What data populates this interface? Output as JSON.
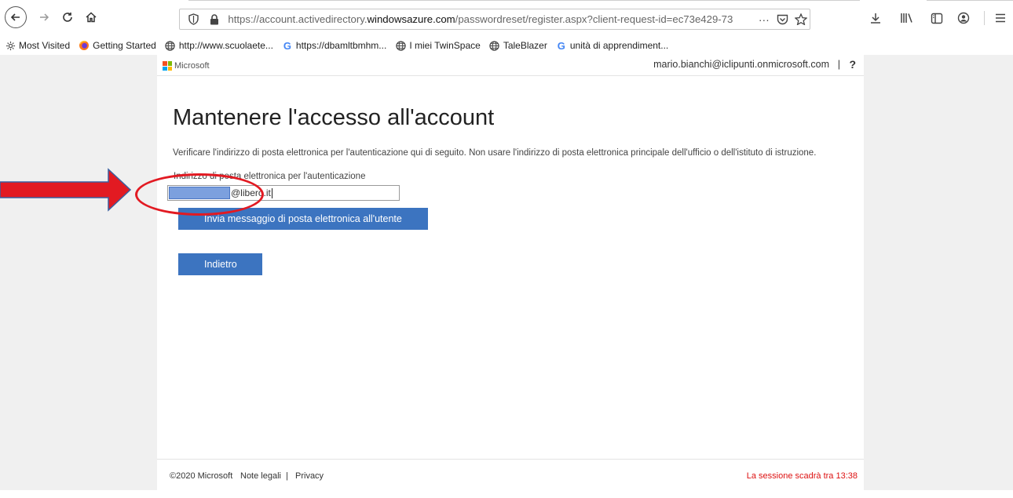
{
  "browser": {
    "url_prefix": "https://account.activedirectory.",
    "url_host": "windowsazure.com",
    "url_suffix": "/passwordreset/register.aspx?client-request-id=ec73e429-73",
    "more_label": "···"
  },
  "bookmarks": [
    {
      "label": "Most Visited",
      "icon": "gear-icon"
    },
    {
      "label": "Getting Started",
      "icon": "firefox-icon"
    },
    {
      "label": "http://www.scuolaete...",
      "icon": "globe-icon"
    },
    {
      "label": "https://dbamltbmhm...",
      "icon": "google-icon"
    },
    {
      "label": "I miei TwinSpace",
      "icon": "globe-icon"
    },
    {
      "label": "TaleBlazer",
      "icon": "globe-icon"
    },
    {
      "label": "unità di apprendiment...",
      "icon": "google-icon"
    }
  ],
  "page": {
    "logo_text": "Microsoft",
    "user_email": "mario.bianchi@iclipunti.onmicrosoft.com",
    "header_sep": "|",
    "help_label": "?",
    "title": "Mantenere l'accesso all'account",
    "instructions": "Verificare l'indirizzo di posta elettronica per l'autenticazione qui di seguito. Non usare l'indirizzo di posta elettronica principale dell'ufficio o dell'istituto di istruzione.",
    "field_label": "Indirizzo di posta elettronica per l'autenticazione",
    "email_value_suffix": "@libero.it",
    "send_button": "Invia messaggio di posta elettronica all'utente",
    "back_button": "Indietro"
  },
  "footer": {
    "copyright": "©2020 Microsoft",
    "legal": "Note legali",
    "sep": "|",
    "privacy": "Privacy",
    "session": "La sessione scadrà tra 13:38"
  },
  "colors": {
    "accent_button": "#3c74c0",
    "annotation_red": "#e21a22",
    "session_text": "#dd1111"
  }
}
